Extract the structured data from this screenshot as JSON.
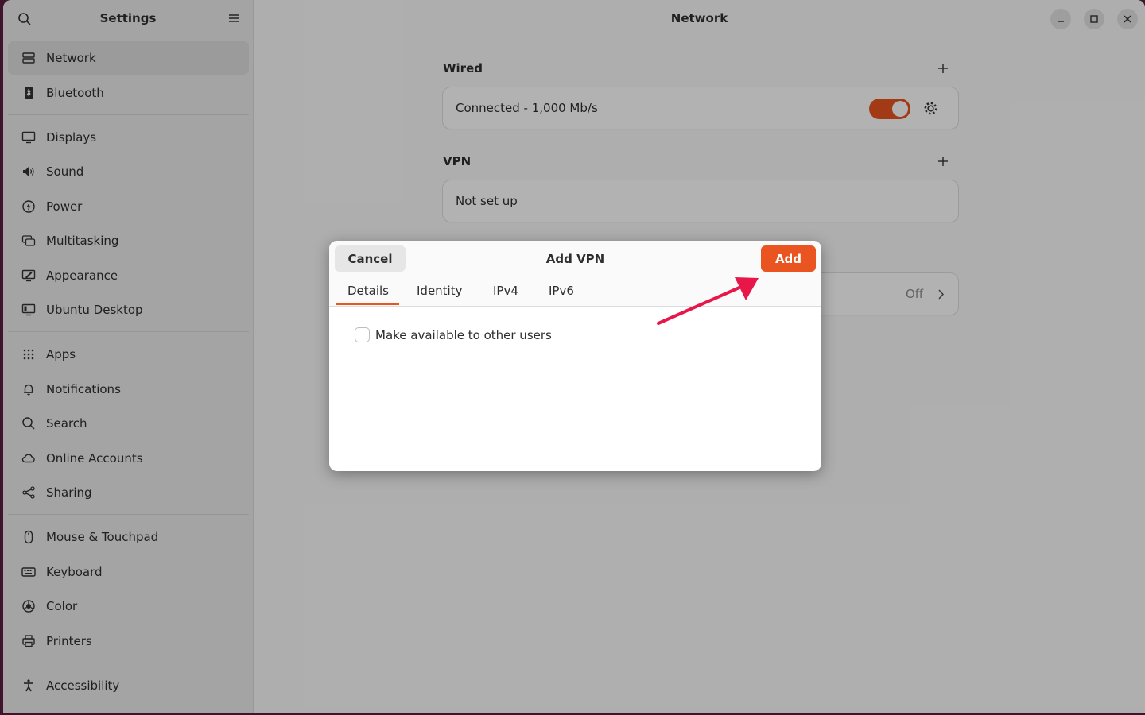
{
  "sidebar": {
    "title": "Settings",
    "groups": [
      [
        {
          "label": "Network",
          "icon": "network-icon",
          "active": true
        },
        {
          "label": "Bluetooth",
          "icon": "bluetooth-icon"
        }
      ],
      [
        {
          "label": "Displays",
          "icon": "display-icon"
        },
        {
          "label": "Sound",
          "icon": "speaker-icon"
        },
        {
          "label": "Power",
          "icon": "power-icon"
        },
        {
          "label": "Multitasking",
          "icon": "multitasking-icon"
        },
        {
          "label": "Appearance",
          "icon": "appearance-icon"
        },
        {
          "label": "Ubuntu Desktop",
          "icon": "ubuntu-desktop-icon"
        }
      ],
      [
        {
          "label": "Apps",
          "icon": "apps-grid-icon"
        },
        {
          "label": "Notifications",
          "icon": "bell-icon"
        },
        {
          "label": "Search",
          "icon": "search-icon"
        },
        {
          "label": "Online Accounts",
          "icon": "cloud-icon"
        },
        {
          "label": "Sharing",
          "icon": "share-icon"
        }
      ],
      [
        {
          "label": "Mouse & Touchpad",
          "icon": "mouse-icon"
        },
        {
          "label": "Keyboard",
          "icon": "keyboard-icon"
        },
        {
          "label": "Color",
          "icon": "color-icon"
        },
        {
          "label": "Printers",
          "icon": "printer-icon"
        }
      ],
      [
        {
          "label": "Accessibility",
          "icon": "accessibility-icon"
        }
      ]
    ]
  },
  "main": {
    "title": "Network",
    "wired": {
      "title": "Wired",
      "status": "Connected - 1,000 Mb/s",
      "enabled": true
    },
    "vpn": {
      "title": "VPN",
      "status": "Not set up"
    },
    "proxy": {
      "state": "Off"
    }
  },
  "dialog": {
    "title": "Add VPN",
    "cancel_label": "Cancel",
    "add_label": "Add",
    "tabs": [
      {
        "label": "Details",
        "active": true
      },
      {
        "label": "Identity"
      },
      {
        "label": "IPv4"
      },
      {
        "label": "IPv6"
      }
    ],
    "checkbox_label": "Make available to other users",
    "checkbox_checked": false
  },
  "colors": {
    "accent": "#e95420",
    "annotation_arrow": "#e8174a"
  }
}
